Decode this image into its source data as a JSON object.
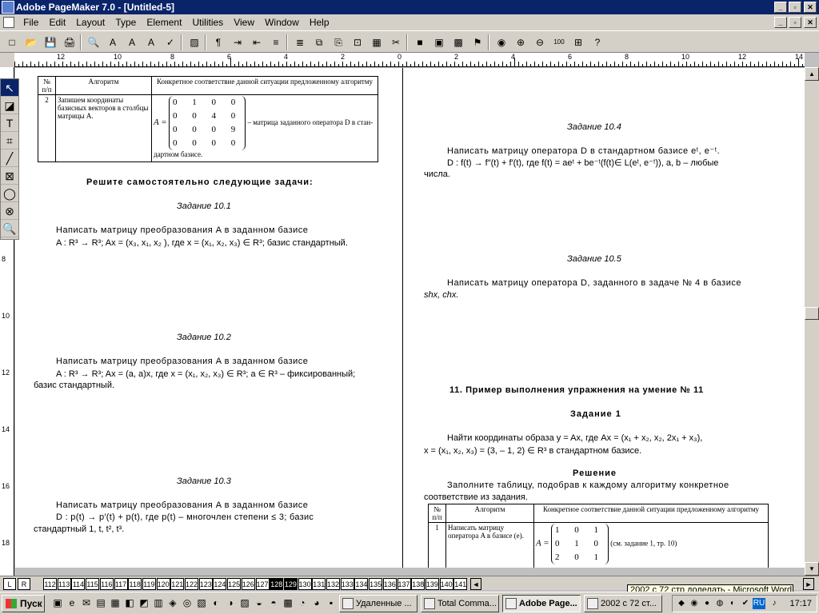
{
  "window": {
    "title": "Adobe PageMaker 7.0 - [Untitled-5]",
    "caption_buttons": [
      "_",
      "▫",
      "✕"
    ],
    "doc_caption_buttons": [
      "_",
      "▫",
      "✕"
    ]
  },
  "menu": [
    "File",
    "Edit",
    "Layout",
    "Type",
    "Element",
    "Utilities",
    "View",
    "Window",
    "Help"
  ],
  "toolbar": {
    "icons": [
      "new-icon",
      "open-icon",
      "save-icon",
      "print-icon",
      "find-icon",
      "type-spec-icon",
      "type-size-up-icon",
      "type-size-down-icon",
      "spelling-icon",
      "fill-icon",
      "paragraph-icon",
      "tab-icon",
      "indent-icon",
      "bullets-icon",
      "numbering-icon",
      "copy-icon",
      "paste-icon",
      "link-icon",
      "place-icon",
      "cut-icon",
      "color-icon",
      "picture-icon",
      "image-icon",
      "acrobat-icon",
      "web-icon",
      "zoom-in-icon",
      "zoom-out-icon",
      "actual-size-icon",
      "fit-icon",
      "help-icon"
    ],
    "glyphs": [
      "□",
      "📂",
      "💾",
      "🖨",
      "🔍",
      "A",
      "A",
      "A",
      "✓",
      "▨",
      "¶",
      "⇥",
      "⇤",
      "≡",
      "≣",
      "⧉",
      "⎘",
      "⊡",
      "▦",
      "✂",
      "■",
      "▣",
      "▩",
      "⚑",
      "◉",
      "⊕",
      "⊖",
      "100",
      "⊞",
      "?"
    ]
  },
  "h_ruler": {
    "labels": [
      "12",
      "10",
      "8",
      "6",
      "4",
      "2",
      "0",
      "2",
      "4",
      "6",
      "8",
      "10",
      "12",
      "14"
    ]
  },
  "v_ruler": {
    "labels": [
      "8",
      "10",
      "12",
      "14",
      "16",
      "18"
    ]
  },
  "toolbox": {
    "tools": [
      "↖",
      "◪",
      "T",
      "⌗",
      "╱",
      "⊠",
      "◯",
      "⊗",
      "🔍"
    ]
  },
  "left_page": {
    "table": {
      "headers": [
        "№ п/п",
        "Алгоритм",
        "Конкретное соответствие данной ситуации предложенному алгоритму"
      ],
      "row_num": "2",
      "row_algo": "Запишем координаты базисных векторов в столбцы матрицы A.",
      "matrix_label": "A =",
      "matrix_rows": [
        "0 1 0 0",
        "0 0 4 0",
        "0 0 0 9",
        "0 0 0 0"
      ],
      "matrix_note": "– матрица заданного оператора D в стан-",
      "matrix_note2": "дартном базисе."
    },
    "heading": "Решите самостоятельно следующие задачи:",
    "tasks": [
      {
        "title": "Задание 10.1",
        "line1": "Написать матрицу преобразования A в заданном базисе",
        "line2": "A : R³ → R³;   Ax = (x₃, x₁, x₂ ), где x = (x₁, x₂, x₃) ∈ R³; базис стандартный.",
        "line3": ""
      },
      {
        "title": "Задание 10.2",
        "line1": "Написать матрицу преобразования A в заданном базисе",
        "line2": "A : R³ → R³;   Ax = (a, a)x, где x = (x₁, x₂, x₃) ∈ R³; a ∈ R³ – фиксированный;",
        "line3": "базис стандартный."
      },
      {
        "title": "Задание 10.3",
        "line1": "Написать матрицу преобразования A в заданном базисе",
        "line2": "D : p(t) → p′(t) + p(t), где p(t) – многочлен степени ≤ 3; базис",
        "line3": "стандартный 1, t, t², t³."
      }
    ]
  },
  "right_page": {
    "task104": {
      "title": "Задание 10.4",
      "line1": "Написать матрицу оператора D в стандартном базисе eᵗ, e⁻ᵗ.",
      "line2": "D : f(t) → f″(t) + f′(t), где f(t) = aeᵗ + be⁻ᵗ(f(t)∈ L(eᵗ, e⁻ᵗ)),   a, b – любые",
      "line3": "числа."
    },
    "task105": {
      "title": "Задание 10.5",
      "line1": "Написать матрицу оператора D, заданного в задаче № 4 в базисе",
      "line2": "shx, chx."
    },
    "section": "11. Пример выполнения упражнения на умение № 11",
    "task1": {
      "title": "Задание 1",
      "line1": "Найти координаты образа y = Ax, где Ax = (x₁ + x₂, x₂, 2x₁ + x₃),",
      "line2": "x = (x₁, x₂, x₃) = (3, – 1, 2) ∈ R³ в стандартном базисе."
    },
    "solution": "Решение",
    "fill1": "Заполните таблицу, подобрав к каждому алгоритму конкретное",
    "fill2": "соответствие из задания.",
    "table": {
      "headers": [
        "№ п/п",
        "Алгоритм",
        "Конкретное соответствие данной ситуации предложенному алгоритму"
      ],
      "row_num": "1",
      "row_algo": "Написать матрицу оператора A в базисе (e).",
      "matrix_label": "A =",
      "matrix_rows": [
        "1 0 1",
        "0 1 0",
        "2 0 1"
      ],
      "matrix_note": "(см. задание 1, тр. 10)"
    }
  },
  "page_tabs": {
    "lr": [
      "L",
      "R"
    ],
    "pages": [
      "112",
      "113",
      "114",
      "115",
      "116",
      "117",
      "118",
      "119",
      "120",
      "121",
      "122",
      "123",
      "124",
      "125",
      "126",
      "127",
      "128",
      "129",
      "130",
      "131",
      "132",
      "133",
      "134",
      "135",
      "136",
      "137",
      "138",
      "139",
      "140",
      "141"
    ],
    "active": [
      "128",
      "129"
    ]
  },
  "tooltip": "2002 с 72 стр доделать - Microsoft Word",
  "taskbar": {
    "start": "Пуск",
    "tasks": [
      {
        "label": "Удаленные ...",
        "active": false
      },
      {
        "label": "Total Comma...",
        "active": false
      },
      {
        "label": "Adobe Page...",
        "active": true
      },
      {
        "label": "2002 с 72 ст...",
        "active": false
      }
    ],
    "lang": "RU",
    "clock": "17:17"
  }
}
